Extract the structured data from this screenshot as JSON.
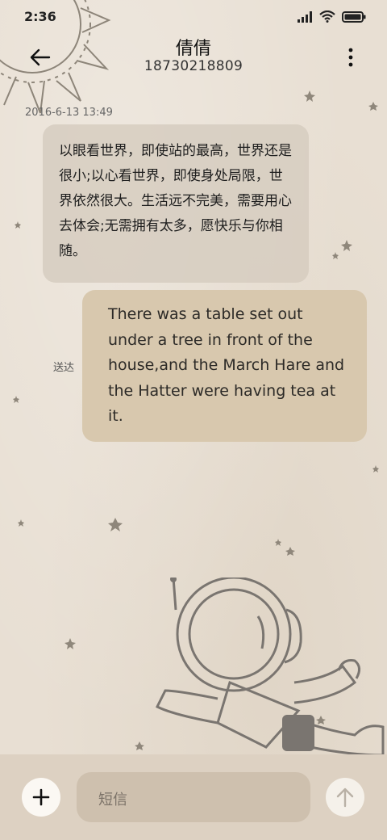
{
  "status_bar": {
    "time": "2:36"
  },
  "header": {
    "contact_name": "倩倩",
    "contact_number": "18730218809"
  },
  "conversation": {
    "timestamp": "2016-6-13 13:49",
    "messages": [
      {
        "direction": "incoming",
        "text": "以眼看世界，即使站的最高，世界还是很小;以心看世界，即使身处局限，世界依然很大。生活远不完美，需要用心去体会;无需拥有太多，愿快乐与你相随。"
      },
      {
        "direction": "outgoing",
        "text": "There was a table set out under a tree in front of the house,and the March Hare and the Hatter were having tea at it.",
        "status": "送达"
      }
    ]
  },
  "composer": {
    "placeholder": "短信"
  },
  "icons": {
    "back": "arrow-left-icon",
    "menu": "more-vertical-icon",
    "add": "plus-icon",
    "send": "arrow-up-icon",
    "signal": "signal-icon",
    "wifi": "wifi-icon",
    "battery": "battery-icon"
  },
  "colors": {
    "background": "#e8dfd3",
    "incoming_bubble": "#d6ccbf",
    "outgoing_bubble": "#d8c8ae",
    "bottom_bar": "#ddd1c2"
  }
}
